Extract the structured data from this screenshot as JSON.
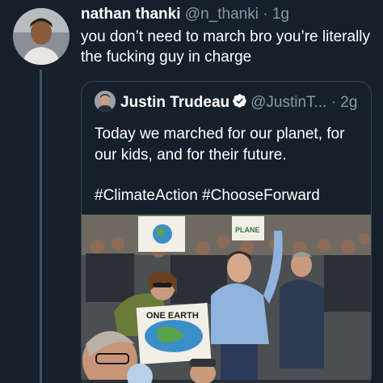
{
  "tweet": {
    "display_name": "nathan thanki",
    "handle": "@n_thanki",
    "separator": "·",
    "time": "1g",
    "text": "you don’t need to march bro you’re literally the fucking guy in charge"
  },
  "quoted_tweet": {
    "display_name": "Justin Trudeau",
    "handle": "@JustinT...",
    "separator": "·",
    "time": "2g",
    "text": "Today we marched for our planet, for our kids, and for their future.",
    "hashtags": "#ClimateAction #ChooseForward",
    "verified_icon": "verified-badge-icon",
    "media": {
      "description_icon": "photo",
      "signs": [
        "ONE EARTH",
        "PLANE"
      ]
    }
  },
  "colors": {
    "background": "#15202b",
    "secondary_text": "#8899a6",
    "border": "#38444d",
    "verified": "#ffffff"
  }
}
